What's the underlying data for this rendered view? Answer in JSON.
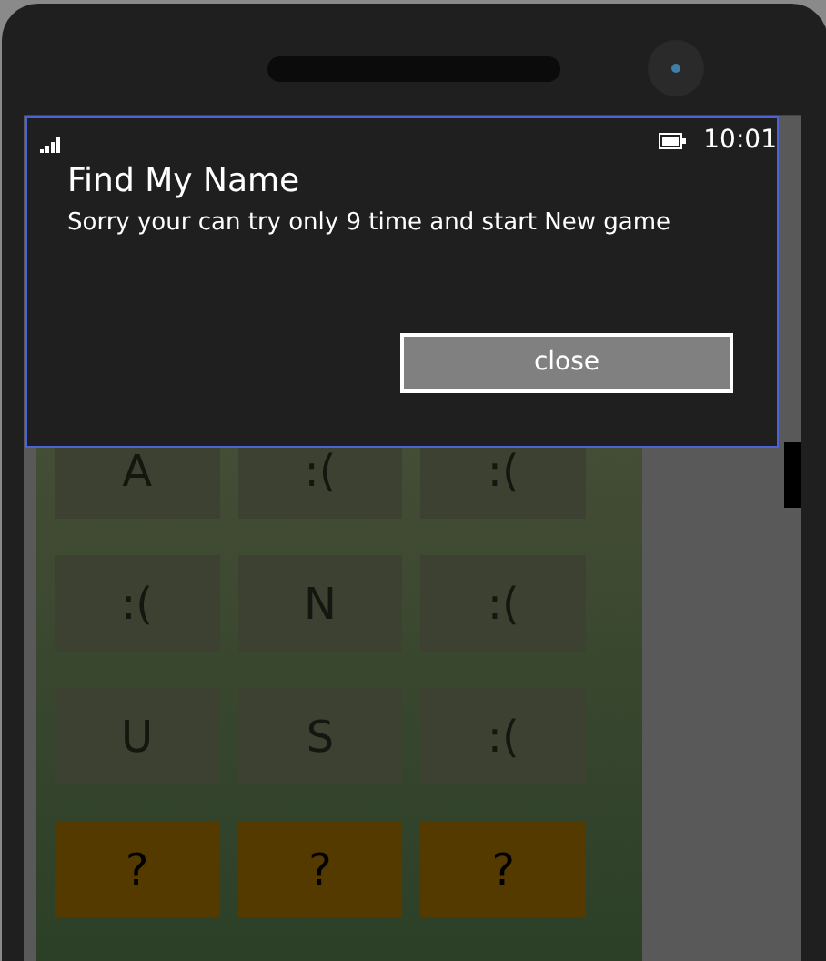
{
  "status_bar": {
    "time": "10:01"
  },
  "dialog": {
    "title": "Find My Name",
    "message": "Sorry your can try only 9 time and start New game",
    "button": "close"
  },
  "tiles": [
    {
      "label": "A",
      "kind": "letter"
    },
    {
      "label": ":(",
      "kind": "letter"
    },
    {
      "label": ":(",
      "kind": "letter"
    },
    {
      "label": ":(",
      "kind": "letter"
    },
    {
      "label": "N",
      "kind": "letter"
    },
    {
      "label": ":(",
      "kind": "letter"
    },
    {
      "label": "U",
      "kind": "letter"
    },
    {
      "label": "S",
      "kind": "letter"
    },
    {
      "label": ":(",
      "kind": "letter"
    },
    {
      "label": "?",
      "kind": "answer"
    },
    {
      "label": "?",
      "kind": "answer"
    },
    {
      "label": "?",
      "kind": "answer"
    }
  ]
}
